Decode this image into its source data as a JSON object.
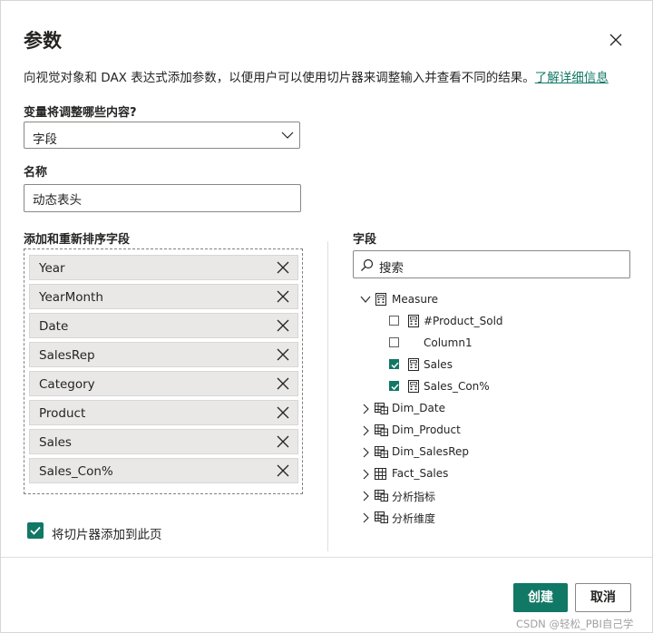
{
  "dialog": {
    "title": "参数",
    "description": "向视觉对象和 DAX 表达式添加参数，以便用户可以使用切片器来调整输入并查看不同的结果。",
    "learn_more": "了解详细信息"
  },
  "variable": {
    "label": "变量将调整哪些内容?",
    "selected": "字段"
  },
  "name": {
    "label": "名称",
    "value": "动态表头"
  },
  "wells": {
    "label": "添加和重新排序字段",
    "items": [
      "Year",
      "YearMonth",
      "Date",
      "SalesRep",
      "Category",
      "Product",
      "Sales",
      "Sales_Con%"
    ]
  },
  "fields": {
    "label": "字段",
    "search_placeholder": "搜索",
    "measure_table": "Measure",
    "measures": [
      {
        "name": "#Product_Sold",
        "checked": false,
        "icon": "calculator-icon"
      },
      {
        "name": "Column1",
        "checked": false,
        "icon": "none"
      },
      {
        "name": "Sales",
        "checked": true,
        "icon": "calculator-icon"
      },
      {
        "name": "Sales_Con%",
        "checked": true,
        "icon": "calculator-icon"
      }
    ],
    "tables": [
      {
        "name": "Dim_Date",
        "icon": "table-icon"
      },
      {
        "name": "Dim_Product",
        "icon": "table-icon"
      },
      {
        "name": "Dim_SalesRep",
        "icon": "table-icon"
      },
      {
        "name": "Fact_Sales",
        "icon": "grid-icon"
      },
      {
        "name": "分析指标",
        "icon": "table-icon"
      },
      {
        "name": "分析维度",
        "icon": "table-icon"
      }
    ]
  },
  "slicer": {
    "label": "将切片器添加到此页",
    "checked": true
  },
  "footer": {
    "create": "创建",
    "cancel": "取消"
  },
  "watermark": "CSDN @轻松_PBI自己学",
  "colors": {
    "accent": "#117865",
    "well_item_bg": "#e9e8e6",
    "border": "#8a8886"
  }
}
